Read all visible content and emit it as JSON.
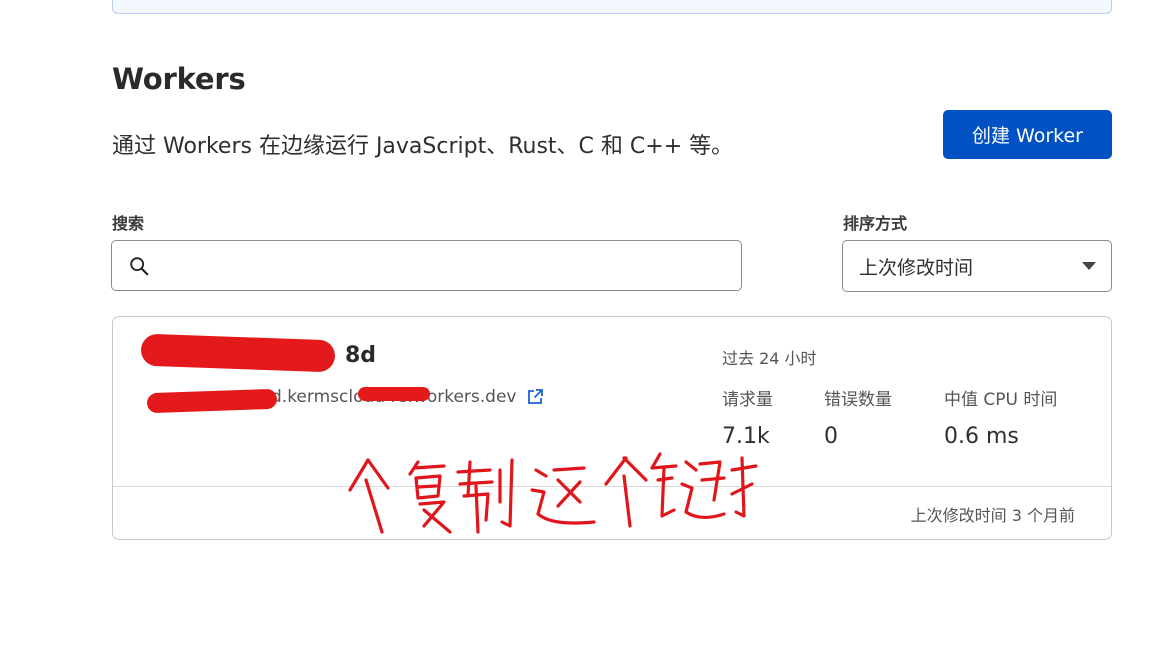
{
  "header": {
    "title": "Workers",
    "description": "通过 Workers 在边缘运行 JavaScript、Rust、C 和 C++ 等。",
    "create_button": "创建 Worker"
  },
  "search": {
    "label": "搜索",
    "value": "",
    "placeholder": ""
  },
  "sort": {
    "label": "排序方式",
    "selected": "上次修改时间"
  },
  "worker": {
    "name_visible": "8d",
    "url_visible": "d.kermscloud   re.workers.dev",
    "stats_period": "过去 24 小时",
    "stats": [
      {
        "label": "请求量",
        "value": "7.1k"
      },
      {
        "label": "错误数量",
        "value": "0"
      },
      {
        "label": "中值 CPU 时间",
        "value": "0.6 ms"
      }
    ],
    "last_modified": "上次修改时间 3 个月前"
  },
  "annotation": {
    "handwritten_note": "个复制这个链接"
  },
  "colors": {
    "primary": "#0051c3",
    "redaction": "#e3191b",
    "banner_bg": "#f3f7fe"
  },
  "icons": {
    "search": "search-icon",
    "external_link": "external-link-icon",
    "caret": "chevron-down-icon"
  }
}
